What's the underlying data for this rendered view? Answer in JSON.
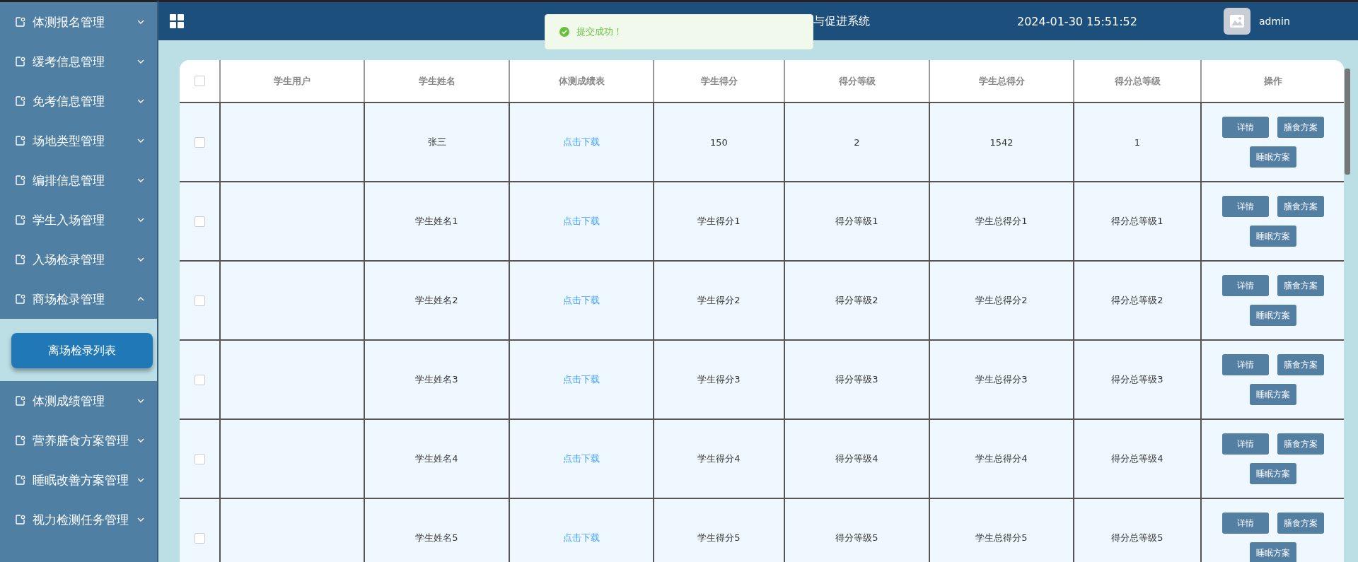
{
  "sidebar": {
    "items": [
      {
        "label": "体测报名管理",
        "expanded": false
      },
      {
        "label": "缓考信息管理",
        "expanded": false
      },
      {
        "label": "免考信息管理",
        "expanded": false
      },
      {
        "label": "场地类型管理",
        "expanded": false
      },
      {
        "label": "编排信息管理",
        "expanded": false
      },
      {
        "label": "学生入场管理",
        "expanded": false
      },
      {
        "label": "入场检录管理",
        "expanded": false
      },
      {
        "label": "商场检录管理",
        "expanded": true,
        "children": [
          {
            "label": "离场检录列表",
            "selected": true
          }
        ]
      },
      {
        "label": "体测成绩管理",
        "expanded": false
      },
      {
        "label": "营养膳食方案管理",
        "expanded": false
      },
      {
        "label": "睡眠改善方案管理",
        "expanded": false
      },
      {
        "label": "视力检测任务管理",
        "expanded": false
      }
    ]
  },
  "header": {
    "title": "与促进系统",
    "datetime": "2024-01-30 15:51:52",
    "user": "admin"
  },
  "toast": {
    "message": "提交成功！"
  },
  "table": {
    "header_checked": false,
    "columns": [
      "学生用户",
      "学生姓名",
      "体测成绩表",
      "学生得分",
      "得分等级",
      "学生总得分",
      "得分总等级",
      "操作"
    ],
    "rows": [
      {
        "checked": false,
        "name": "张三",
        "report_link": "点击下载",
        "score": "150",
        "grade": "2",
        "total_score": "1542",
        "total_grade": "1",
        "actions": [
          "详情",
          "膳食方案",
          "睡眠方案"
        ]
      },
      {
        "checked": false,
        "name": "学生姓名1",
        "report_link": "点击下载",
        "score": "学生得分1",
        "grade": "得分等级1",
        "total_score": "学生总得分1",
        "total_grade": "得分总等级1",
        "actions": [
          "详情",
          "膳食方案",
          "睡眠方案"
        ]
      },
      {
        "checked": false,
        "name": "学生姓名2",
        "report_link": "点击下载",
        "score": "学生得分2",
        "grade": "得分等级2",
        "total_score": "学生总得分2",
        "total_grade": "得分总等级2",
        "actions": [
          "详情",
          "膳食方案",
          "睡眠方案"
        ]
      },
      {
        "checked": false,
        "name": "学生姓名3",
        "report_link": "点击下载",
        "score": "学生得分3",
        "grade": "得分等级3",
        "total_score": "学生总得分3",
        "total_grade": "得分总等级3",
        "actions": [
          "详情",
          "膳食方案",
          "睡眠方案"
        ]
      },
      {
        "checked": false,
        "name": "学生姓名4",
        "report_link": "点击下载",
        "score": "学生得分4",
        "grade": "得分等级4",
        "total_score": "学生总得分4",
        "total_grade": "得分总等级4",
        "actions": [
          "详情",
          "膳食方案",
          "睡眠方案"
        ]
      },
      {
        "checked": false,
        "name": "学生姓名5",
        "report_link": "点击下载",
        "score": "学生得分5",
        "grade": "得分等级5",
        "total_score": "学生总得分5",
        "total_grade": "得分总等级5",
        "actions": [
          "详情",
          "膳食方案",
          "睡眠方案"
        ]
      }
    ]
  }
}
